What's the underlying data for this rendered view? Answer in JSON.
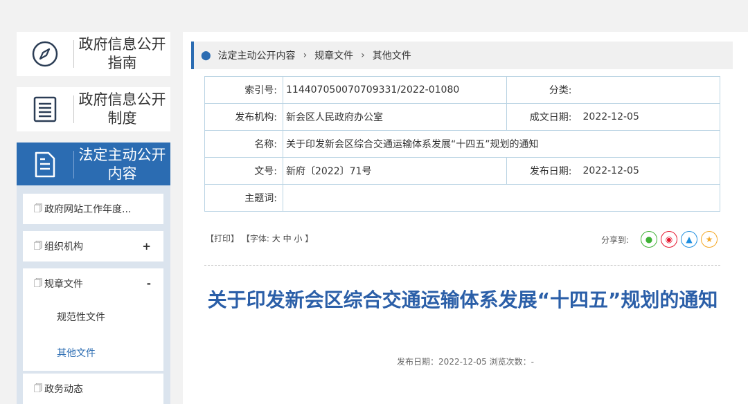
{
  "sidebar": {
    "cards": [
      {
        "label": "政府信息公开指南",
        "icon": "compass-icon"
      },
      {
        "label": "政府信息公开制度",
        "icon": "list-icon"
      },
      {
        "label": "法定主动公开内容",
        "icon": "document-icon",
        "active": true
      }
    ],
    "items": [
      {
        "label": "政府网站工作年度...",
        "toggle": ""
      },
      {
        "label": "组织机构",
        "toggle": "+"
      },
      {
        "label": "规章文件",
        "toggle": "-"
      },
      {
        "label": "政务动态",
        "toggle": ""
      }
    ],
    "children": [
      "规范性文件",
      "其他文件"
    ]
  },
  "breadcrumb": [
    "法定主动公开内容",
    "规章文件",
    "其他文件"
  ],
  "meta": {
    "index_label": "索引号:",
    "index_value": "114407050070709331/2022-01080",
    "category_label": "分类:",
    "category_value": "",
    "issuer_label": "发布机构:",
    "issuer_value": "新会区人民政府办公室",
    "created_label": "成文日期:",
    "created_value": "2022-12-05",
    "name_label": "名称:",
    "name_value": "关于印发新会区综合交通运输体系发展“十四五”规划的通知",
    "docno_label": "文号:",
    "docno_value": "新府〔2022〕71号",
    "published_label": "发布日期:",
    "published_value": "2022-12-05",
    "keywords_label": "主题词:",
    "keywords_value": ""
  },
  "tools": {
    "print": "【打印】",
    "font_prefix": "【字体:",
    "large": "大",
    "medium": "中",
    "small": "小",
    "font_suffix": "】"
  },
  "share": {
    "label": "分享到:",
    "icons": [
      "wechat-icon",
      "weibo-icon",
      "qq-icon",
      "qzone-icon"
    ]
  },
  "article": {
    "title": "关于印发新会区综合交通运输体系发展“十四五”规划的通知",
    "pubinfo": "发布日期：2022-12-05  浏览次数：-"
  },
  "colors": {
    "accent": "#2b6cb2",
    "title": "#2b5fa8",
    "wechat": "#3eb135",
    "weibo": "#e6162d",
    "qq": "#1e8fe1",
    "qzone": "#f5a623"
  }
}
